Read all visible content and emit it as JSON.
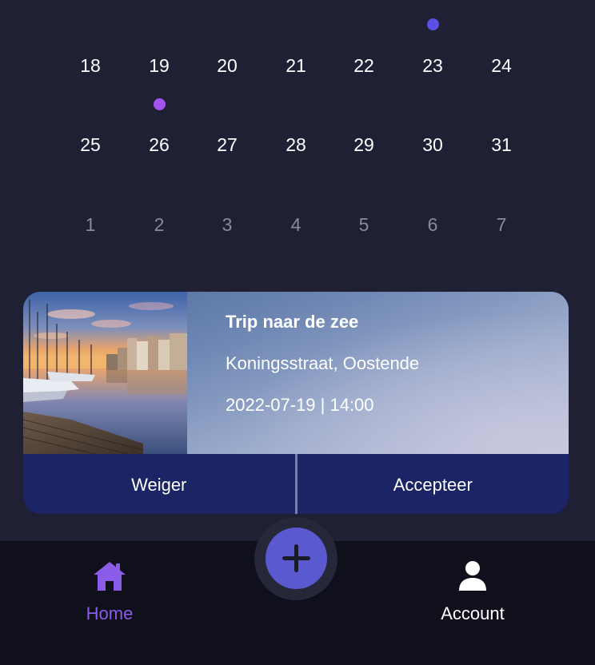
{
  "calendar": {
    "rows": [
      {
        "days": [
          {
            "label": "18"
          },
          {
            "label": "19"
          },
          {
            "label": "20"
          },
          {
            "label": "21"
          },
          {
            "label": "22"
          },
          {
            "label": "23"
          },
          {
            "label": "24"
          }
        ]
      },
      {
        "days": [
          {
            "label": "25"
          },
          {
            "label": "26"
          },
          {
            "label": "27"
          },
          {
            "label": "28"
          },
          {
            "label": "29"
          },
          {
            "label": "30"
          },
          {
            "label": "31"
          }
        ]
      },
      {
        "days": [
          {
            "label": "1",
            "muted": true
          },
          {
            "label": "2",
            "muted": true
          },
          {
            "label": "3",
            "muted": true
          },
          {
            "label": "4",
            "muted": true
          },
          {
            "label": "5",
            "muted": true
          },
          {
            "label": "6",
            "muted": true
          },
          {
            "label": "7",
            "muted": true
          }
        ]
      }
    ],
    "event_markers": [
      {
        "day": "23",
        "color": "#5b4fe6"
      },
      {
        "day": "26",
        "color": "#a452f0"
      }
    ]
  },
  "event_card": {
    "image_icon": "marina-photo",
    "title": "Trip naar de zee",
    "address": "Koningsstraat, Oostende",
    "datetime": "2022-07-19 | 14:00",
    "decline_label": "Weiger",
    "accept_label": "Accepteer"
  },
  "bottom_nav": {
    "home_label": "Home",
    "home_icon": "home-icon",
    "add_icon": "plus-icon",
    "account_label": "Account",
    "account_icon": "user-icon",
    "active_color": "#8a5ce8"
  },
  "colors": {
    "background": "#1f2034",
    "nav_background": "#0f101c",
    "card_actions": "#1b2464",
    "fab": "#5a59cf"
  }
}
